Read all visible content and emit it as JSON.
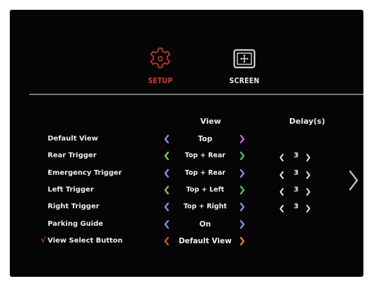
{
  "tabs": [
    {
      "label": "SETUP",
      "icon": "gear-icon",
      "color": "#d63a2a",
      "active": true
    },
    {
      "label": "SCREEN",
      "icon": "screen-move-icon",
      "color": "#e9e9e9",
      "active": false
    }
  ],
  "columns": {
    "view": "View",
    "delay": "Delay(s)"
  },
  "rows": [
    {
      "label": "Default View",
      "value": "Top",
      "arrow_left_color": "#8a8cf0",
      "arrow_right_color": "#c06ad8",
      "delay": null
    },
    {
      "label": "Rear Trigger",
      "value": "Top + Rear",
      "arrow_left_color": "#7ec64a",
      "arrow_right_color": "#4cc26a",
      "delay": "3"
    },
    {
      "label": "Emergency Trigger",
      "value": "Top + Rear",
      "arrow_left_color": "#8a8cf0",
      "arrow_right_color": "#8a8cf0",
      "delay": "3"
    },
    {
      "label": "Left Trigger",
      "value": "Top + Left",
      "arrow_left_color": "#7ec64a",
      "arrow_right_color": "#4cc26a",
      "delay": "3"
    },
    {
      "label": "Right Trigger",
      "value": "Top + Right",
      "arrow_left_color": "#8a8cf0",
      "arrow_right_color": "#8a8cf0",
      "delay": "3"
    },
    {
      "label": "Parking Guide",
      "value": "On",
      "arrow_left_color": "#8a8cf0",
      "arrow_right_color": "#8a8cf0",
      "delay": null
    },
    {
      "label": "View Select Button",
      "value": "Default View",
      "arrow_left_color": "#e04a28",
      "arrow_right_color": "#f07a28",
      "delay": null,
      "checked": true,
      "check_mark": "√"
    }
  ],
  "colors": {
    "accent": "#d63a2a",
    "background": "#050505",
    "text": "#f2f2f2",
    "divider": "#7a7a7a"
  }
}
